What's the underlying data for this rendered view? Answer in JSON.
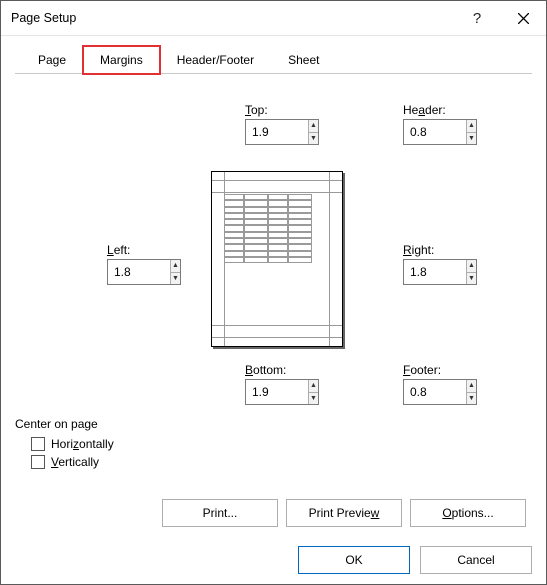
{
  "titlebar": {
    "title": "Page Setup",
    "help_tooltip": "?",
    "close_tooltip": "Close"
  },
  "tabs": {
    "page": "Page",
    "margins": "Margins",
    "header_footer": "Header/Footer",
    "sheet": "Sheet",
    "active": "margins"
  },
  "margins": {
    "top": {
      "label_pre": "",
      "key": "T",
      "label_post": "op:",
      "value": "1.9"
    },
    "header": {
      "label_pre": "He",
      "key": "a",
      "label_post": "der:",
      "value": "0.8"
    },
    "left": {
      "label_pre": "",
      "key": "L",
      "label_post": "eft:",
      "value": "1.8"
    },
    "right": {
      "label_pre": "",
      "key": "R",
      "label_post": "ight:",
      "value": "1.8"
    },
    "bottom": {
      "label_pre": "",
      "key": "B",
      "label_post": "ottom:",
      "value": "1.9"
    },
    "footer": {
      "label_pre": "",
      "key": "F",
      "label_post": "ooter:",
      "value": "0.8"
    }
  },
  "center": {
    "title": "Center on page",
    "horizontally": {
      "pre": "Hori",
      "key": "z",
      "post": "ontally",
      "checked": false
    },
    "vertically": {
      "pre": "",
      "key": "V",
      "post": "ertically",
      "checked": false
    }
  },
  "buttons": {
    "print": "Print...",
    "print_preview_pre": "Print Previe",
    "print_preview_key": "w",
    "print_preview_post": "",
    "options_pre": "",
    "options_key": "O",
    "options_post": "ptions...",
    "ok": "OK",
    "cancel": "Cancel"
  }
}
